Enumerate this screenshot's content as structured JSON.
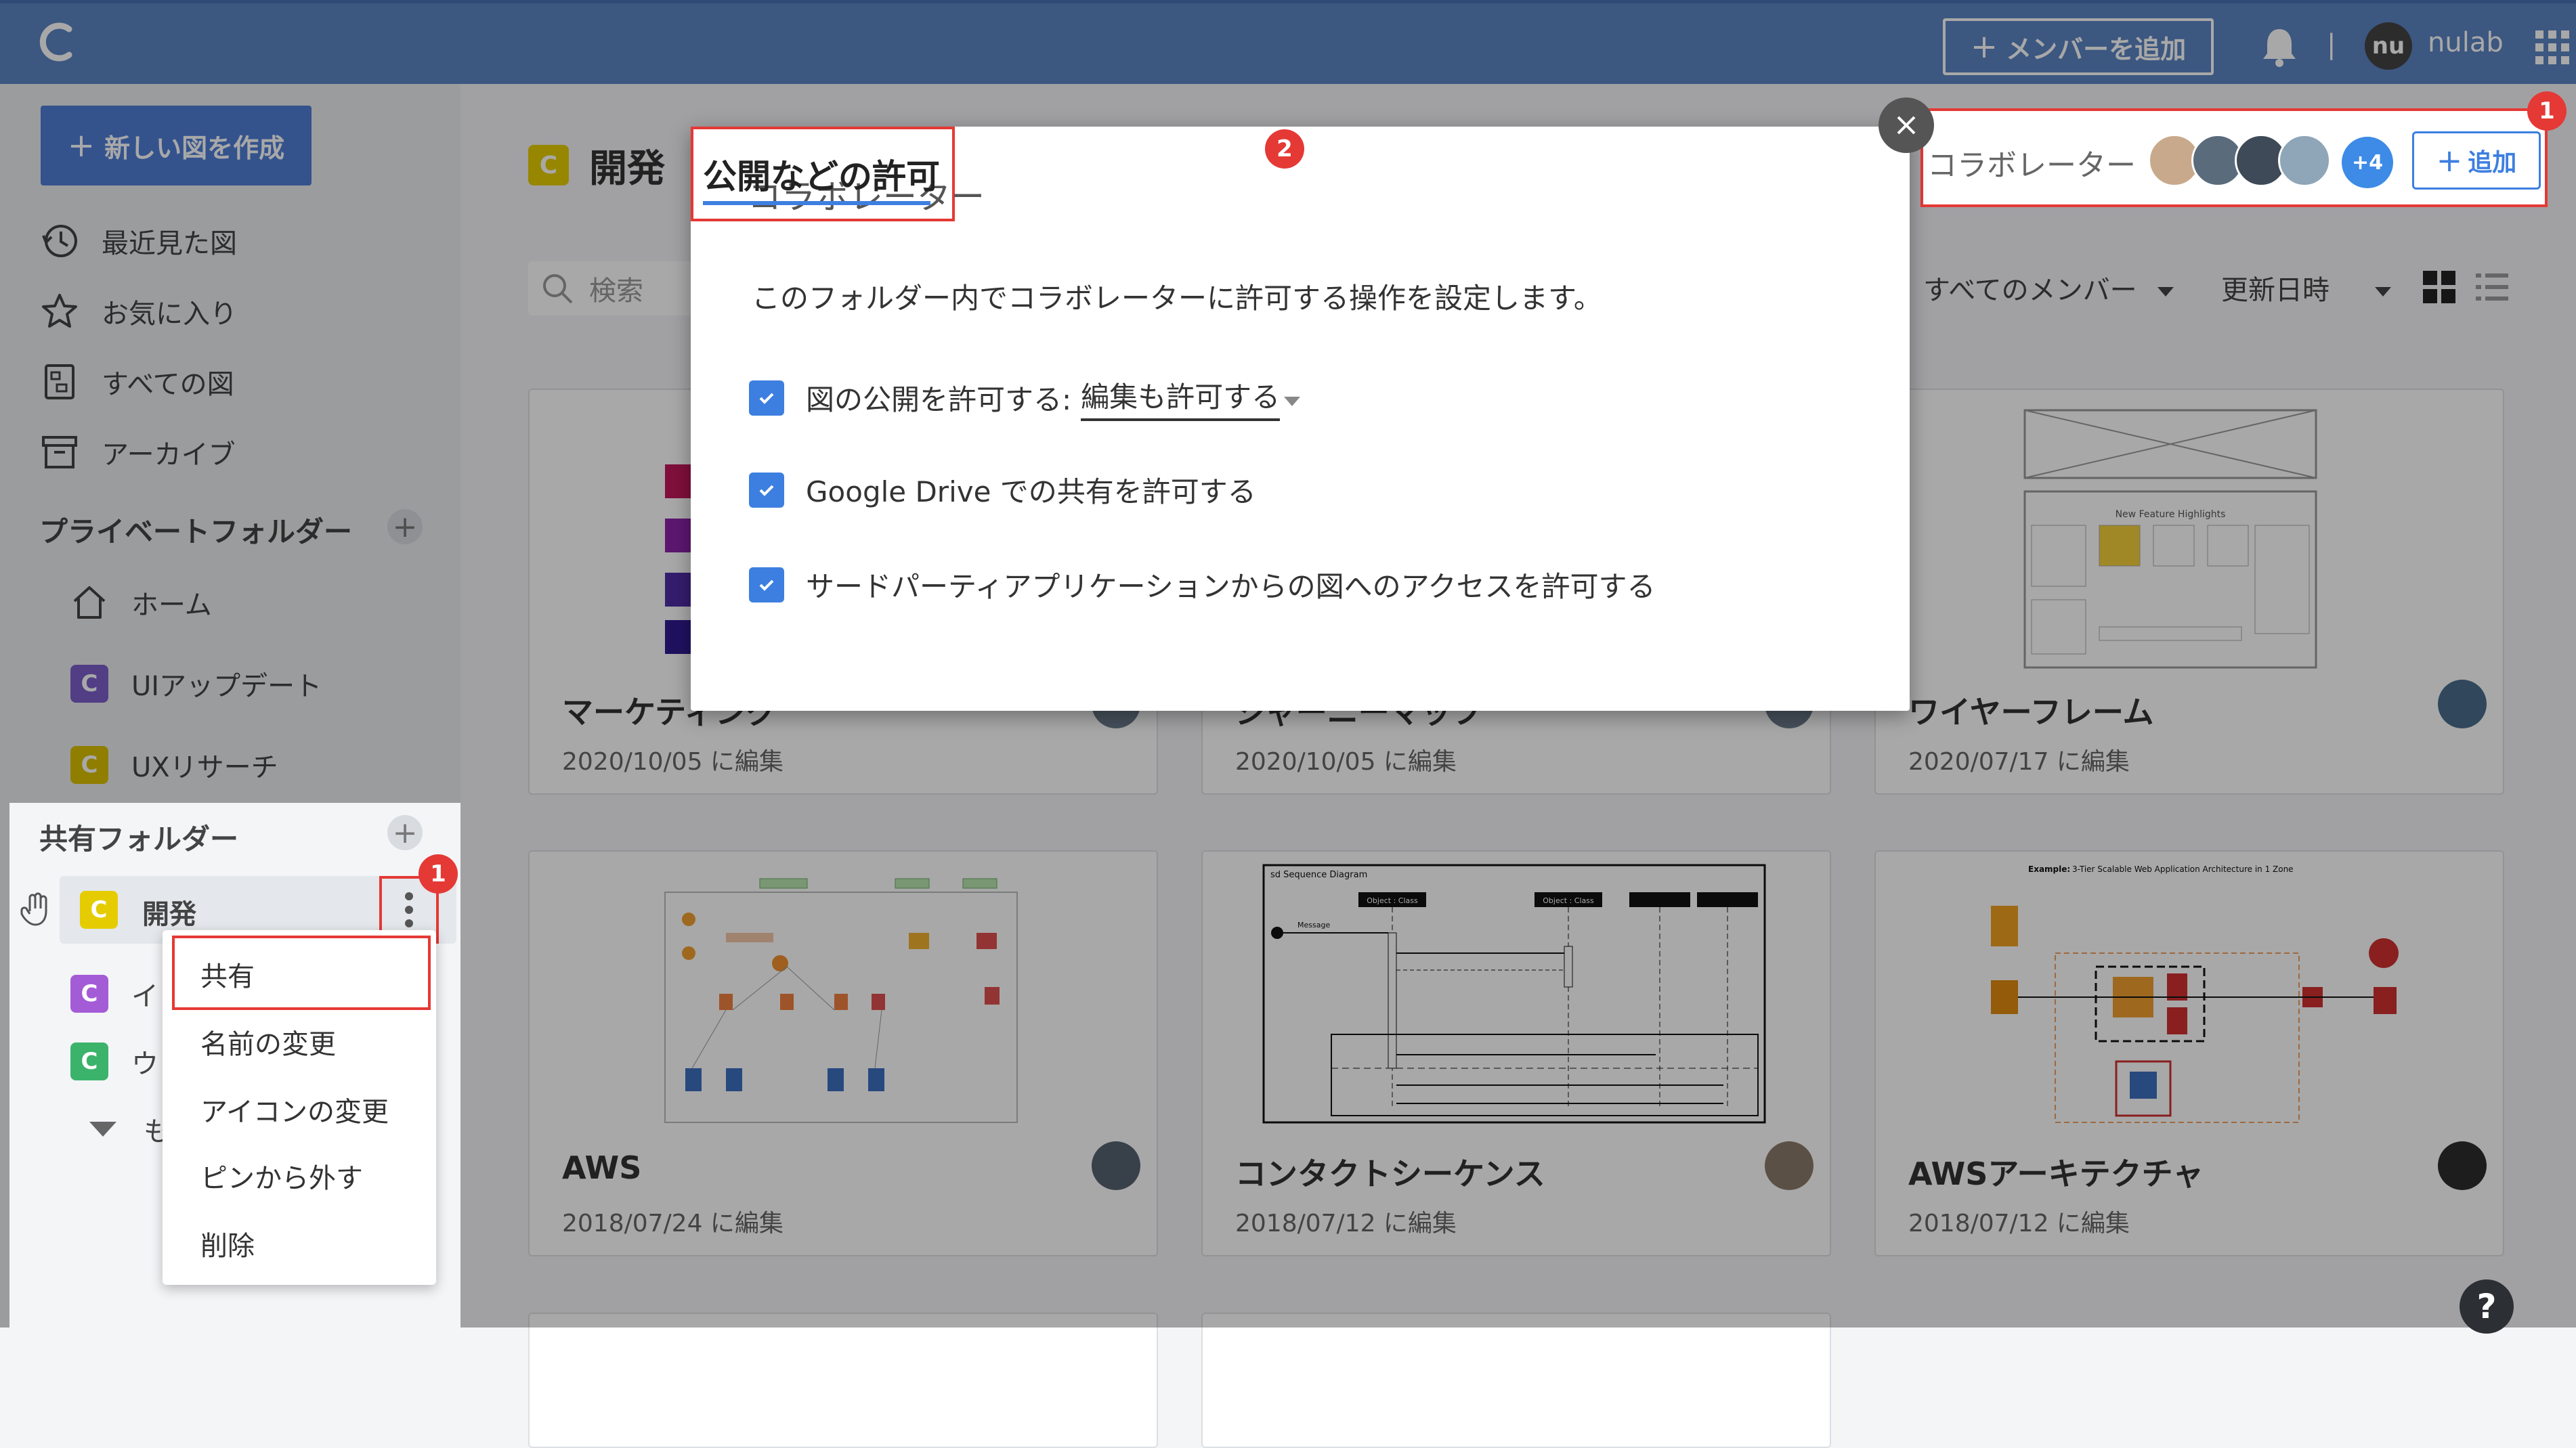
{
  "topbar": {
    "add_member_label": "メンバーを追加",
    "add_member_plus": "+",
    "separator": "|",
    "user_initials": "nu",
    "user_name": "nulab"
  },
  "sidebar": {
    "new_diagram_label": "新しい図を作成",
    "new_diagram_plus": "+",
    "nav": [
      {
        "label": "最近見た図",
        "icon": "history-icon"
      },
      {
        "label": "お気に入り",
        "icon": "star-icon"
      },
      {
        "label": "すべての図",
        "icon": "diagrams-icon"
      },
      {
        "label": "アーカイブ",
        "icon": "archive-icon"
      }
    ],
    "private_title": "プライベートフォルダー",
    "private_folders": [
      {
        "label": "ホーム",
        "icon": "home-icon"
      },
      {
        "label": "UIアップデート",
        "badge": "C",
        "color": "#7b5fc9"
      },
      {
        "label": "UXリサーチ",
        "badge": "C",
        "color": "#d9bf00"
      }
    ],
    "shared_title": "共有フォルダー",
    "shared_folders": [
      {
        "label": "開発",
        "badge": "C",
        "color": "#e5cc00"
      },
      {
        "label": "イ",
        "badge": "C",
        "color": "#a35cd6"
      },
      {
        "label": "ウ",
        "badge": "C",
        "color": "#3bb36b"
      }
    ],
    "more_label": "も",
    "plus": "+"
  },
  "context_menu": {
    "items": [
      "共有",
      "名前の変更",
      "アイコンの変更",
      "ピンから外す",
      "削除"
    ],
    "step_badge": "1"
  },
  "main": {
    "folder_badge": "C",
    "folder_title": "開発",
    "search_placeholder": "検索",
    "filter_members": "すべてのメンバー",
    "sort_label": "更新日時",
    "cards": [
      {
        "title": "マーケティング",
        "date": "2020/10/05 に編集"
      },
      {
        "title": "ジャーニーマップ",
        "date": "2020/10/05 に編集"
      },
      {
        "title": "ワイヤーフレーム",
        "date": "2020/07/17 に編集"
      },
      {
        "title": "AWS",
        "date": "2018/07/24 に編集"
      },
      {
        "title": "コンタクトシーケンス",
        "date": "2018/07/12 に編集"
      },
      {
        "title": "AWSアーキテクチャ",
        "date": "2018/07/12 に編集"
      }
    ],
    "thumb_texts": {
      "wireframe_heading": "New Feature Highlights",
      "sequence_title": "sd Sequence Diagram",
      "sequence_object": "Object : Class",
      "sequence_message": "Message",
      "aws_title_prefix": "Example:",
      "aws_title": "3-Tier Scalable Web Application Architecture in 1 Zone"
    }
  },
  "collab_bar": {
    "label": "コラボレーター",
    "more_count": "+4",
    "add_label": "追加",
    "add_plus": "+",
    "step_badge": "1",
    "avatar_colors": [
      "#c9a98b",
      "#5a6b7c",
      "#3e4a57",
      "#8fa5b8"
    ]
  },
  "dialog": {
    "tab_collaborators": "コラボレーター",
    "tab_permissions": "公開などの許可",
    "step_badge": "2",
    "description": "このフォルダー内でコラボレーターに許可する操作を設定します。",
    "options": [
      {
        "label": "図の公開を許可する:",
        "select": "編集も許可する",
        "checked": true
      },
      {
        "label": "Google Drive での共有を許可する",
        "checked": true
      },
      {
        "label": "サードパーティアプリケーションからの図へのアクセスを許可する",
        "checked": true
      }
    ]
  },
  "help_label": "?",
  "colors": {
    "topbar": "#5b84c3",
    "accent": "#3d7fe0",
    "highlight": "#e53935"
  }
}
